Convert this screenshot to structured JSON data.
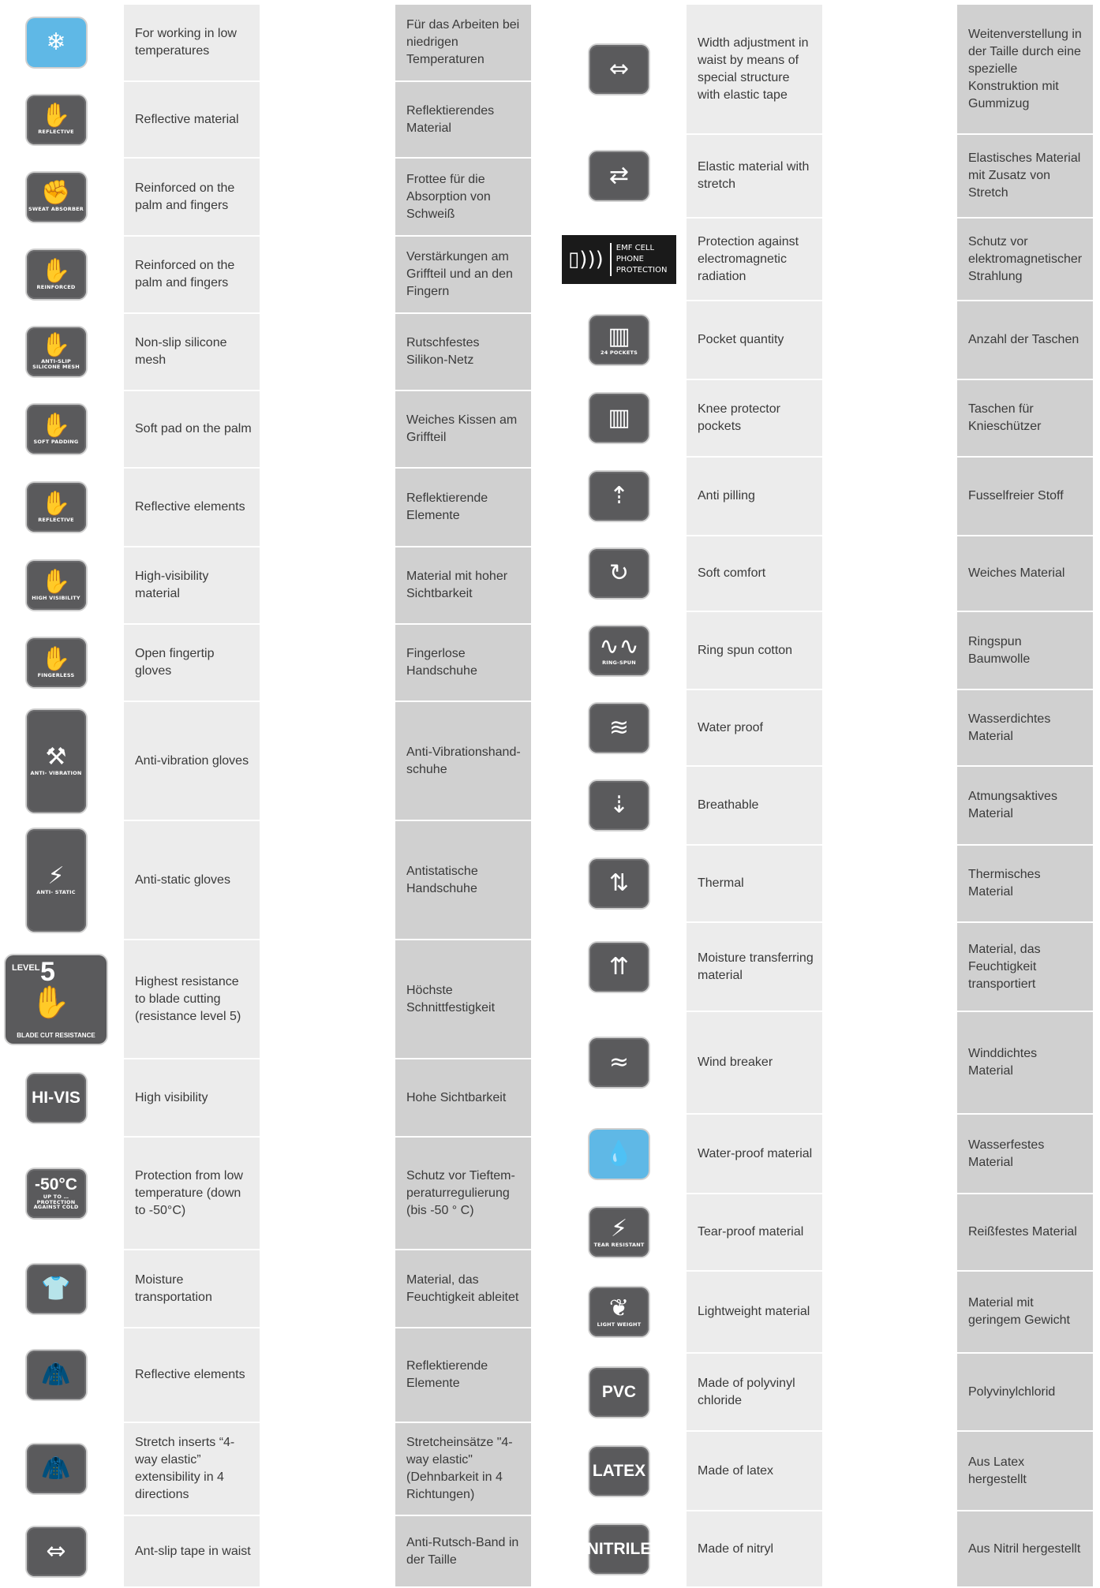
{
  "left_rows": [
    {
      "icon": "snowflake-icon",
      "glyph": "❄",
      "caption": "",
      "style": "blue",
      "en": "For working in low temperatures",
      "de": "Für das Arbeiten bei niedrigen Temperaturen"
    },
    {
      "icon": "reflective-glove-icon",
      "glyph": "✋",
      "caption": "REFLECTIVE",
      "style": "",
      "en": "Reflective material",
      "de": "Reflektierendes Material"
    },
    {
      "icon": "sweat-absorber-icon",
      "glyph": "✊",
      "caption": "SWEAT ABSORBER",
      "style": "",
      "en": "Reinforced on the palm and fingers",
      "de": "Frottee für die Absorption von Schweiß"
    },
    {
      "icon": "reinforced-glove-icon",
      "glyph": "✋",
      "caption": "REINFORCED",
      "style": "",
      "en": "Reinforced on the palm and fingers",
      "de": "Verstärkungen am Griffteil und an den Fingern"
    },
    {
      "icon": "anti-slip-mesh-icon",
      "glyph": "✋",
      "caption": "ANTI-SLIP SILICONE MESH",
      "style": "",
      "en": "Non-slip silicone mesh",
      "de": "Rutschfestes Silikon-Netz"
    },
    {
      "icon": "soft-padding-icon",
      "glyph": "✋",
      "caption": "SOFT PADDING",
      "style": "",
      "en": "Soft pad on the palm",
      "de": "Weiches Kissen am Griffteil"
    },
    {
      "icon": "reflective-elements-glove-icon",
      "glyph": "✋",
      "caption": "REFLECTIVE",
      "style": "",
      "en": "Reflective elements",
      "de": "Reflektierende Elemente"
    },
    {
      "icon": "high-visibility-glove-icon",
      "glyph": "✋",
      "caption": "HIGH VISIBILITY",
      "style": "",
      "en": "High-visibility material",
      "de": "Material mit hoher Sichtbarkeit"
    },
    {
      "icon": "fingerless-glove-icon",
      "glyph": "✋",
      "caption": "FINGERLESS",
      "style": "",
      "en": "Open fingertip gloves",
      "de": "Fingerlose Handschuhe"
    },
    {
      "icon": "anti-vibration-icon",
      "glyph": "⚒",
      "caption": "ANTI- VIBRATION",
      "style": "tall",
      "en": "Anti-vibration gloves",
      "de": "Anti-Vibrationshand-schuhe"
    },
    {
      "icon": "anti-static-icon",
      "glyph": "⚡",
      "caption": "ANTI- STATIC",
      "style": "tall",
      "en": "Anti-static gloves",
      "de": "Antistatische Handschuhe"
    },
    {
      "icon": "blade-cut-resistance-icon",
      "glyph": "",
      "caption": "BLADE CUT RESISTANCE",
      "style": "level5",
      "en": "Highest resistance to blade cutting (resistance level 5)",
      "de": "Höchste Schnittfestigkeit",
      "level_label": "LEVEL",
      "level_num": "5"
    },
    {
      "icon": "hi-vis-icon",
      "glyph": "HI-VIS",
      "caption": "",
      "style": "big-text",
      "en": "High visibility",
      "de": "Hohe Sichtbarkeit"
    },
    {
      "icon": "minus-50-icon",
      "glyph": "-50°C",
      "caption": "UP TO … PROTECTION AGAINST COLD",
      "style": "big-text",
      "en": "Protection from low temperature (down to -50°C)",
      "de": "Schutz vor Tieftem-peraturregulierung (bis -50 ° C)"
    },
    {
      "icon": "moisture-transport-icon",
      "glyph": "👕",
      "caption": "",
      "style": "",
      "en": "Moisture transportation",
      "de": "Material, das Feuchtigkeit ableitet"
    },
    {
      "icon": "jacket-reflective-icon",
      "glyph": "🧥",
      "caption": "",
      "style": "",
      "en": "Reflective elements",
      "de": "Reflektierende Elemente"
    },
    {
      "icon": "jacket-stretch-icon",
      "glyph": "🧥",
      "caption": "",
      "style": "",
      "en": "Stretch inserts “4-way elastic” extensibility in 4 directions",
      "de": "Stretcheinsätze \"4-way elastic\" (Dehnbarkeit in 4 Richtungen)"
    },
    {
      "icon": "anti-slip-waist-icon",
      "glyph": "⇔",
      "caption": "",
      "style": "",
      "en": "Ant-slip tape in waist",
      "de": "Anti-Rutsch-Band in der Taille"
    }
  ],
  "right_rows": [
    {
      "icon": "waist-adjust-icon",
      "glyph": "⇔",
      "caption": "",
      "style": "",
      "en": "Width adjustment in waist by means of special structure with elastic tape",
      "de": "Weitenverstellung in der Taille durch eine spezielle Konstruktion mit Gummizug"
    },
    {
      "icon": "stretch-material-icon",
      "glyph": "⇄",
      "caption": "",
      "style": "",
      "en": "Elastic material with stretch",
      "de": "Elastisches Material mit Zusatz von Stretch"
    },
    {
      "icon": "emf-icon",
      "glyph": "▯)))",
      "caption": "EMF CELL PHONE PROTECTION",
      "style": "emf",
      "en": "Protection against electromagnetic radiation",
      "de": "Schutz vor elektromagnetischer Strahlung"
    },
    {
      "icon": "pockets-icon",
      "glyph": "▥",
      "caption": "24 POCKETS",
      "style": "",
      "en": "Pocket quantity",
      "de": "Anzahl der Taschen"
    },
    {
      "icon": "knee-pockets-icon",
      "glyph": "▥",
      "caption": "",
      "style": "",
      "en": "Knee protector pockets",
      "de": "Taschen für Knieschützer"
    },
    {
      "icon": "anti-pilling-icon",
      "glyph": "⇡",
      "caption": "",
      "style": "",
      "en": "Anti pilling",
      "de": "Fusselfreier Stoff"
    },
    {
      "icon": "soft-comfort-icon",
      "glyph": "↻",
      "caption": "",
      "style": "",
      "en": "Soft comfort",
      "de": "Weiches Material"
    },
    {
      "icon": "ring-spun-icon",
      "glyph": "∿∿",
      "caption": "RING-SPUN",
      "style": "",
      "en": "Ring spun cotton",
      "de": "Ringspun Baumwolle"
    },
    {
      "icon": "water-proof-icon",
      "glyph": "≋",
      "caption": "",
      "style": "",
      "en": "Water proof",
      "de": "Wasserdichtes Material"
    },
    {
      "icon": "breathable-icon",
      "glyph": "⇣",
      "caption": "",
      "style": "",
      "en": "Breathable",
      "de": "Atmungsaktives Material"
    },
    {
      "icon": "thermal-icon",
      "glyph": "⇅",
      "caption": "",
      "style": "",
      "en": "Thermal",
      "de": "Thermisches Material"
    },
    {
      "icon": "moisture-transfer-icon",
      "glyph": "⇈",
      "caption": "",
      "style": "",
      "en": "Moisture transferring material",
      "de": "Material, das Feuchtigkeit transportiert"
    },
    {
      "icon": "wind-breaker-icon",
      "glyph": "≈",
      "caption": "",
      "style": "",
      "en": "Wind breaker",
      "de": "Winddichtes Material"
    },
    {
      "icon": "water-proof-material-icon",
      "glyph": "💧",
      "caption": "",
      "style": "blue",
      "en": "Water-proof material",
      "de": "Wasserfestes Material"
    },
    {
      "icon": "tear-resistant-icon",
      "glyph": "⚡",
      "caption": "TEAR RESISTANT",
      "style": "",
      "en": "Tear-proof material",
      "de": "Reißfestes Material"
    },
    {
      "icon": "light-weight-icon",
      "glyph": "❦",
      "caption": "LIGHT WEIGHT",
      "style": "",
      "en": "Lightweight material",
      "de": "Material mit geringem Gewicht"
    },
    {
      "icon": "pvc-icon",
      "glyph": "PVC",
      "caption": "",
      "style": "big-text",
      "en": "Made of polyvinyl chloride",
      "de": "Polyvinylchlorid"
    },
    {
      "icon": "latex-icon",
      "glyph": "LATEX",
      "caption": "",
      "style": "big-text",
      "en": "Made of latex",
      "de": "Aus Latex hergestellt"
    },
    {
      "icon": "nitrile-icon",
      "glyph": "NITRILE",
      "caption": "",
      "style": "big-text",
      "en": "Made of nitryl",
      "de": "Aus Nitril hergestellt"
    }
  ]
}
